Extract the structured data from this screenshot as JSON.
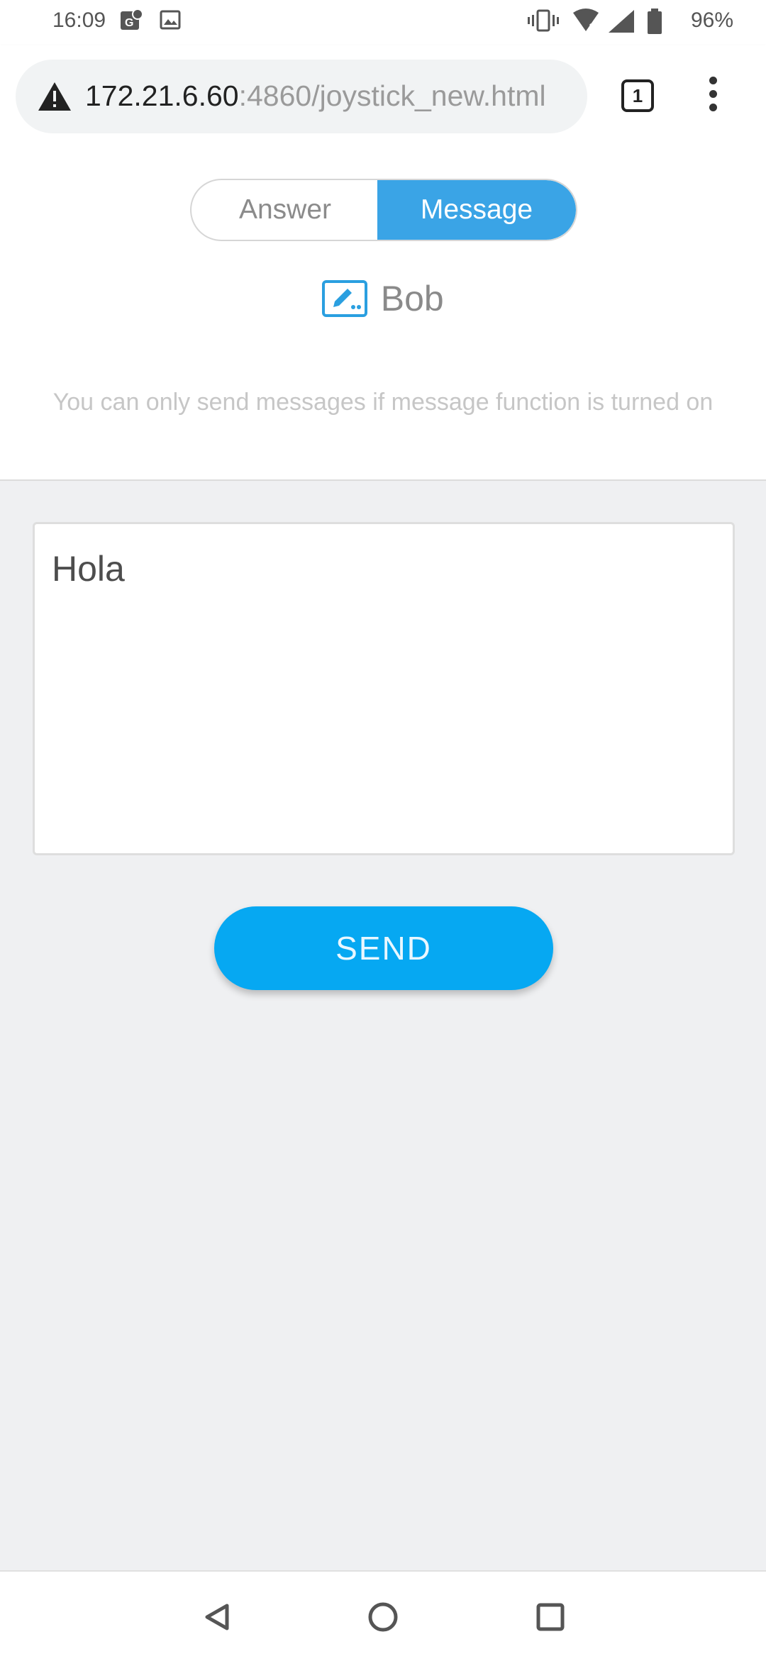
{
  "status_bar": {
    "time": "16:09",
    "battery": "96%",
    "icons": [
      "location-icon",
      "image-icon",
      "vibrate-icon",
      "wifi-icon",
      "signal-icon",
      "battery-icon"
    ]
  },
  "browser": {
    "url_host": "172.21.6.60",
    "url_path": ":4860/joystick_new.html",
    "tab_count": "1",
    "security_icon": "warning-icon"
  },
  "segment": {
    "answer_label": "Answer",
    "message_label": "Message",
    "selected": "Message",
    "accent_color": "#3aa4e6"
  },
  "user": {
    "name": "Bob",
    "icon": "edit-icon"
  },
  "hint_text": "You can only send messages if message function is turned on",
  "message": {
    "value": "Hola"
  },
  "send_button": {
    "label": "SEND",
    "color": "#06a8f2"
  },
  "nav_bar": {
    "items": [
      "back-icon",
      "home-icon",
      "recents-icon"
    ]
  }
}
